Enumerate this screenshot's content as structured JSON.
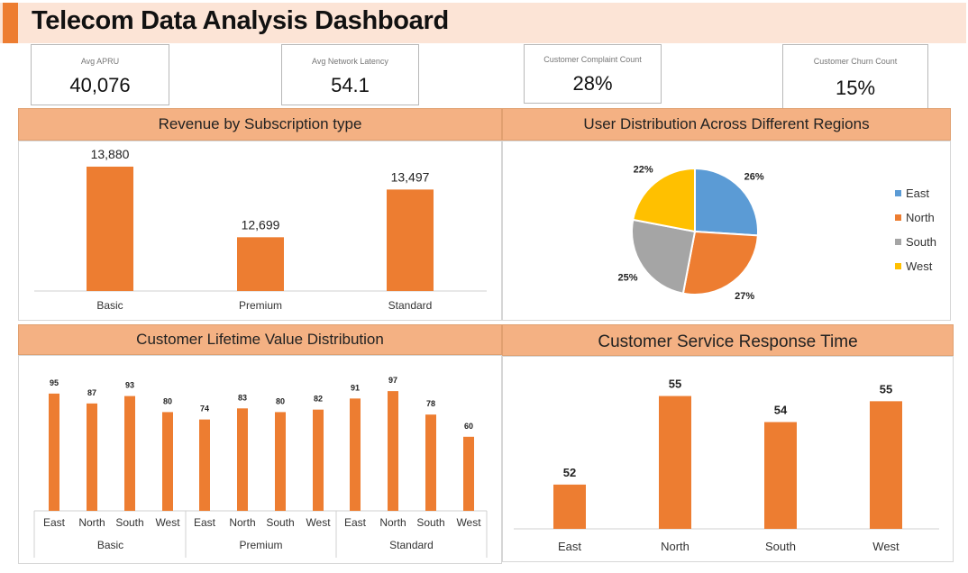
{
  "header": {
    "title": "Telecom Data Analysis Dashboard"
  },
  "kpis": [
    {
      "label": "Avg APRU",
      "value": "40,076"
    },
    {
      "label": "Avg Network Latency",
      "value": "54.1"
    },
    {
      "label": "Customer Complaint Count",
      "value": "28%"
    },
    {
      "label": "Customer Churn Count",
      "value": "15%"
    }
  ],
  "colors": {
    "accent": "#ed7d31",
    "header_fill": "#f4b183",
    "title_fill": "#fce4d6"
  },
  "chart_data": [
    {
      "id": "revenue",
      "type": "bar",
      "title": "Revenue by Subscription type",
      "categories": [
        "Basic",
        "Premium",
        "Standard"
      ],
      "values": [
        13880,
        12699,
        13497
      ],
      "value_labels": [
        "13,880",
        "12,699",
        "13,497"
      ],
      "ylim": [
        11800,
        14000
      ],
      "color": "#ed7d31"
    },
    {
      "id": "regions",
      "type": "pie",
      "title": "User Distribution Across Different Regions",
      "labels": [
        "East",
        "North",
        "South",
        "West"
      ],
      "values": [
        26,
        27,
        25,
        22
      ],
      "value_labels": [
        "26%",
        "27%",
        "25%",
        "22%"
      ],
      "colors": [
        "#5b9bd5",
        "#ed7d31",
        "#a5a5a5",
        "#ffc000"
      ],
      "legend": "right"
    },
    {
      "id": "clv",
      "type": "bar",
      "title": "Customer Lifetime Value Distribution",
      "groups": [
        "Basic",
        "Premium",
        "Standard"
      ],
      "categories": [
        "East",
        "North",
        "South",
        "West"
      ],
      "values": [
        [
          95,
          87,
          93,
          80
        ],
        [
          74,
          83,
          80,
          82
        ],
        [
          91,
          97,
          78,
          60
        ]
      ],
      "ylim": [
        0,
        100
      ],
      "color": "#ed7d31"
    },
    {
      "id": "response",
      "type": "bar",
      "title": "Customer Service Response Time",
      "categories": [
        "East",
        "North",
        "South",
        "West"
      ],
      "values": [
        52,
        55,
        54,
        55
      ],
      "bar_levels": [
        51.7,
        55.1,
        54.1,
        54.9
      ],
      "ylim": [
        50,
        55.5
      ],
      "color": "#ed7d31"
    }
  ]
}
